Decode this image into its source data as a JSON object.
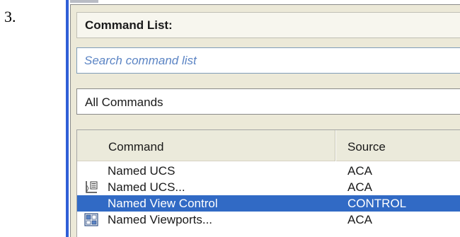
{
  "step_number": "3.",
  "panel": {
    "title": "Command List:",
    "search": {
      "placeholder": "Search command list",
      "value": ""
    },
    "filter": {
      "selected": "All Commands"
    },
    "list": {
      "columns": [
        "Command",
        "Source"
      ],
      "rows": [
        {
          "command": "Named UCS",
          "source": "ACA",
          "icon": null,
          "selected": false
        },
        {
          "command": "Named UCS...",
          "source": "ACA",
          "icon": "ucs-icon",
          "selected": false
        },
        {
          "command": "Named View Control",
          "source": "CONTROL",
          "icon": null,
          "selected": true
        },
        {
          "command": "Named Viewports...",
          "source": "ACA",
          "icon": "viewports-icon",
          "selected": false
        }
      ]
    }
  },
  "colors": {
    "selection": "#316ac5",
    "window_edge": "#2f5fd7",
    "search_placeholder": "#5b84c4",
    "panel_background": "#ece9d8"
  }
}
